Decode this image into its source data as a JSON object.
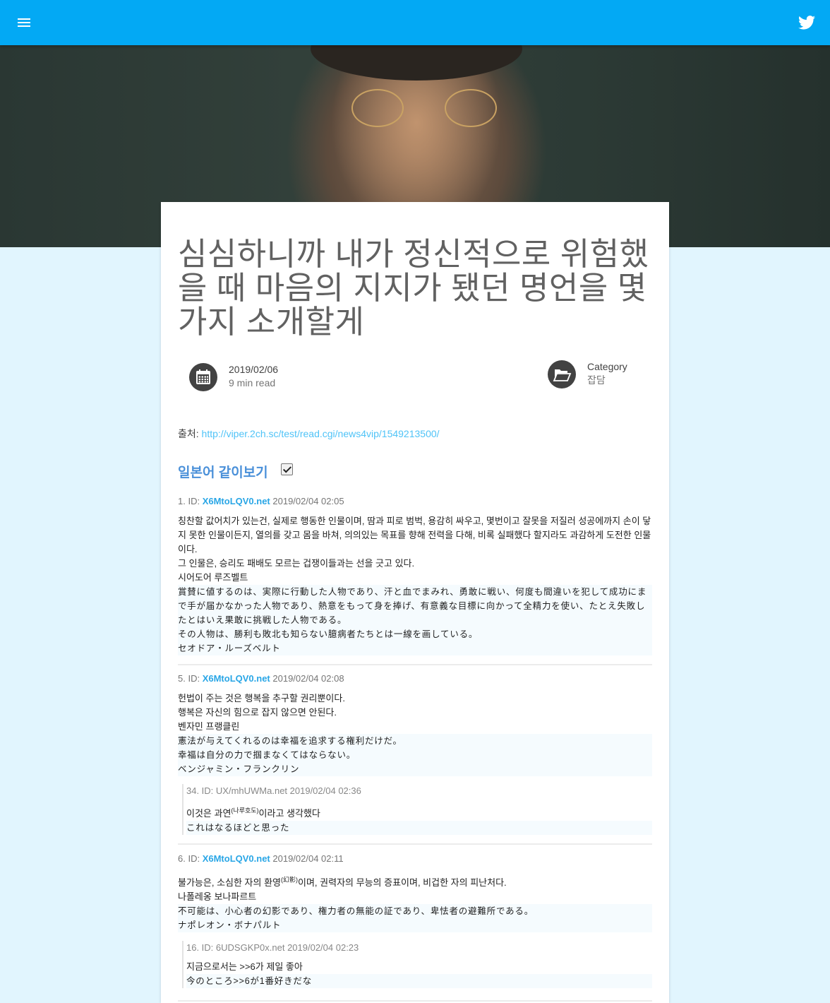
{
  "header": {
    "menu_icon": "menu-icon",
    "twitter_icon": "twitter-icon",
    "bar_color": "#03a9f4"
  },
  "article": {
    "title": "심심하니까 내가 정신적으로 위험했을 때 마음의 지지가 됐던 명언을 몇가지 소개할게",
    "date": "2019/02/06",
    "read_time": "9 min read",
    "category_label": "Category",
    "category": "잡담",
    "source_label": "출처: ",
    "source_url": "http://viper.2ch.sc/test/read.cgi/news4vip/1549213500/",
    "jp_toggle_label": "일본어 같이보기",
    "jp_toggle_checked": true
  },
  "posts": [
    {
      "num": "1. ID: ",
      "uid": "X6MtoLQV0.net",
      "time": " 2019/02/04 02:05",
      "ko": [
        "칭찬할 값어치가 있는건, 실제로 행동한 인물이며, 땀과 피로 범벅, 용감히 싸우고, 몇번이고 잘못을 저질러 성공에까지 손이 닿지 못한 인물이든지, 열의를 갖고 몸을 바쳐, 의의있는 목표를 향해 전력을 다해, 비록 실패했다 할지라도 과감하게 도전한 인물이다.",
        "그 인물은, 승리도 패배도 모르는 겁쟁이들과는 선을 긋고 있다.",
        "시어도어 루즈벨트"
      ],
      "jp": [
        "賞賛に値するのは、実際に行動した人物であり、汗と血でまみれ、勇敢に戦い、何度も間違いを犯して成功にまで手が届かなかった人物であり、熱意をもって身を捧げ、有意義な目標に向かって全精力を使い、たとえ失敗したとはいえ果敢に挑戦した人物である。",
        "その人物は、勝利も敗北も知らない臆病者たちとは一線を画している。",
        "セオドア・ルーズベルト"
      ]
    },
    {
      "num": "5. ID: ",
      "uid": "X6MtoLQV0.net",
      "time": " 2019/02/04 02:08",
      "ko": [
        "헌법이 주는 것은 행복을 추구할 권리뿐이다.",
        "행복은 자신의 힘으로 잡지 않으면 안된다.",
        "벤자민 프랭클린"
      ],
      "jp": [
        "憲法が与えてくれるのは幸福を追求する権利だけだ。",
        "幸福は自分の力で掴まなくてはならない。",
        "ベンジャミン・フランクリン"
      ],
      "reply": {
        "head": "34. ID: UX/mhUWMa.net 2019/02/04 02:36",
        "ko_pre": "이것은 과연",
        "ko_ruby": "(나루호도)",
        "ko_post": "이라고 생각했다",
        "jp": "これはなるほどと思った"
      }
    },
    {
      "num": "6. ID: ",
      "uid": "X6MtoLQV0.net",
      "time": " 2019/02/04 02:11",
      "ko_pre": "불가능은, 소심한 자의 환영",
      "ko_ruby": "(幻影)",
      "ko_post": "이며, 권력자의 무능의 증표이며, 비겁한 자의 피난처다.",
      "ko": [
        "나폴레옹 보나파르트"
      ],
      "jp": [
        "不可能は、小心者の幻影であり、権力者の無能の証であり、卑怯者の避難所である。",
        "ナポレオン・ボナパルト"
      ],
      "reply": {
        "head": "16. ID: 6UDSGKP0x.net 2019/02/04 02:23",
        "ko": "지금으로서는 >>6가 제일 좋아",
        "jp": "今のところ>>6が1番好きだな"
      }
    }
  ]
}
